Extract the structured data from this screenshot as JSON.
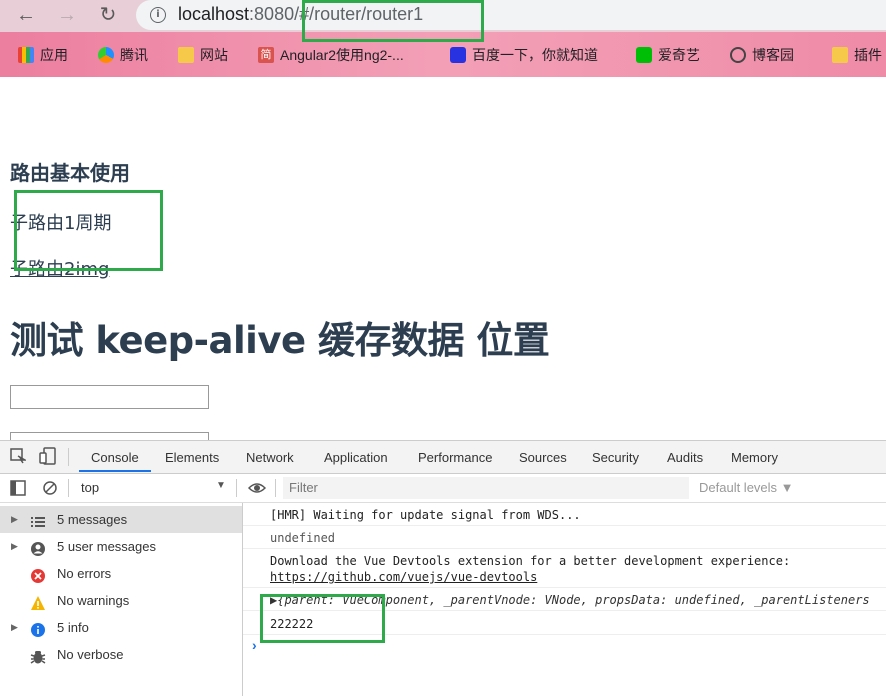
{
  "browser": {
    "url_host": "localhost",
    "url_port": ":8080/",
    "url_path": "#/router/router1",
    "bookmarks": [
      {
        "label": "应用",
        "icon": "apps-grid-icon"
      },
      {
        "label": "腾讯",
        "icon": "tencent-video-icon"
      },
      {
        "label": "网站",
        "icon": "folder-icon"
      },
      {
        "label": "Angular2使用ng2-...",
        "icon": "jian-icon"
      },
      {
        "label": "百度一下，你就知道",
        "icon": "baidu-icon"
      },
      {
        "label": "爱奇艺",
        "icon": "iqiyi-icon"
      },
      {
        "label": "博客园",
        "icon": "cnblogs-icon"
      },
      {
        "label": "插件",
        "icon": "folder-icon"
      }
    ]
  },
  "page": {
    "heading": "路由基本使用",
    "link1": "子路由1周期",
    "link2": "子路由2img",
    "title": "测试 keep-alive 缓存数据 位置"
  },
  "devtools": {
    "tabs": [
      "Console",
      "Elements",
      "Network",
      "Application",
      "Performance",
      "Sources",
      "Security",
      "Audits",
      "Memory"
    ],
    "context": "top",
    "filter_placeholder": "Filter",
    "levels": "Default levels ▼",
    "sidebar": [
      {
        "label": "5 messages",
        "icon": "list-icon",
        "arrow": true,
        "selected": true
      },
      {
        "label": "5 user messages",
        "icon": "user-icon",
        "arrow": true,
        "selected": false
      },
      {
        "label": "No errors",
        "icon": "error-icon",
        "arrow": false,
        "selected": false
      },
      {
        "label": "No warnings",
        "icon": "warning-icon",
        "arrow": false,
        "selected": false
      },
      {
        "label": "5 info",
        "icon": "info-icon",
        "arrow": true,
        "selected": false
      },
      {
        "label": "No verbose",
        "icon": "bug-icon",
        "arrow": false,
        "selected": false
      }
    ],
    "logs": {
      "hmr": "[HMR] Waiting for update signal from WDS...",
      "undef": "undefined",
      "vue_msg": "Download the Vue Devtools extension for a better development experience:",
      "vue_link": "https://github.com/vuejs/vue-devtools",
      "obj": "▶{parent: VueComponent, _parentVnode: VNode, propsData: undefined, _parentListeners",
      "num": "222222"
    },
    "colors": {
      "accent": "#1a73e8",
      "annotation": "#2eaa4a"
    }
  }
}
